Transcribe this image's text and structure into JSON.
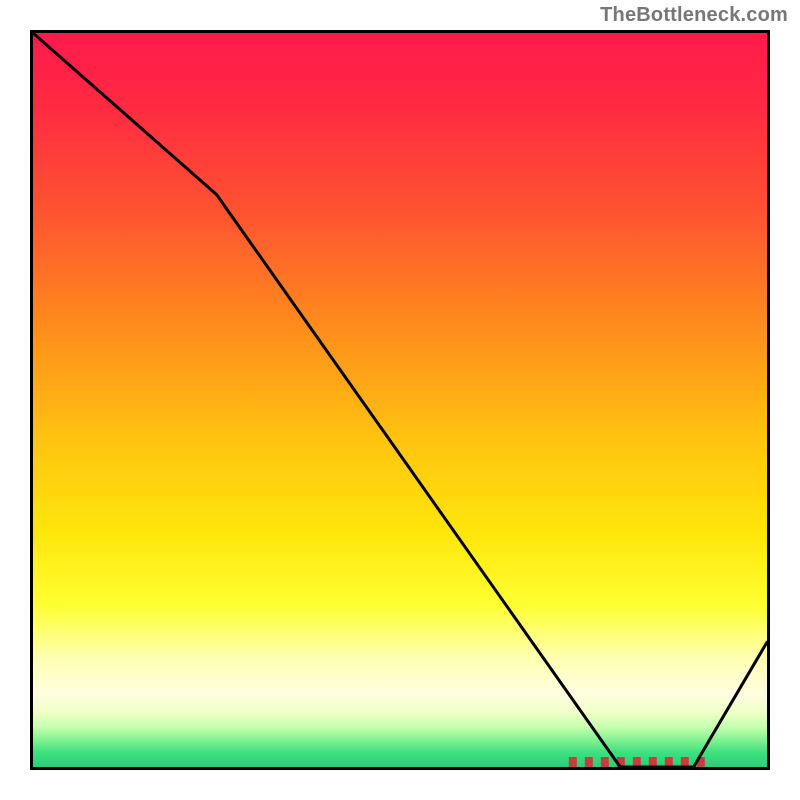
{
  "attribution": "TheBottleneck.com",
  "chart_data": {
    "type": "line",
    "title": "",
    "xlabel": "",
    "ylabel": "",
    "xlim": [
      0,
      100
    ],
    "ylim": [
      0,
      100
    ],
    "x": [
      0,
      25,
      80,
      90,
      100
    ],
    "values": [
      100,
      78,
      0,
      0,
      17
    ],
    "optimal_band": {
      "x_start": 73,
      "x_end": 92,
      "y": 0
    },
    "background": "vertical gradient red→orange→yellow→pale→green",
    "grid": false,
    "legend": null
  }
}
